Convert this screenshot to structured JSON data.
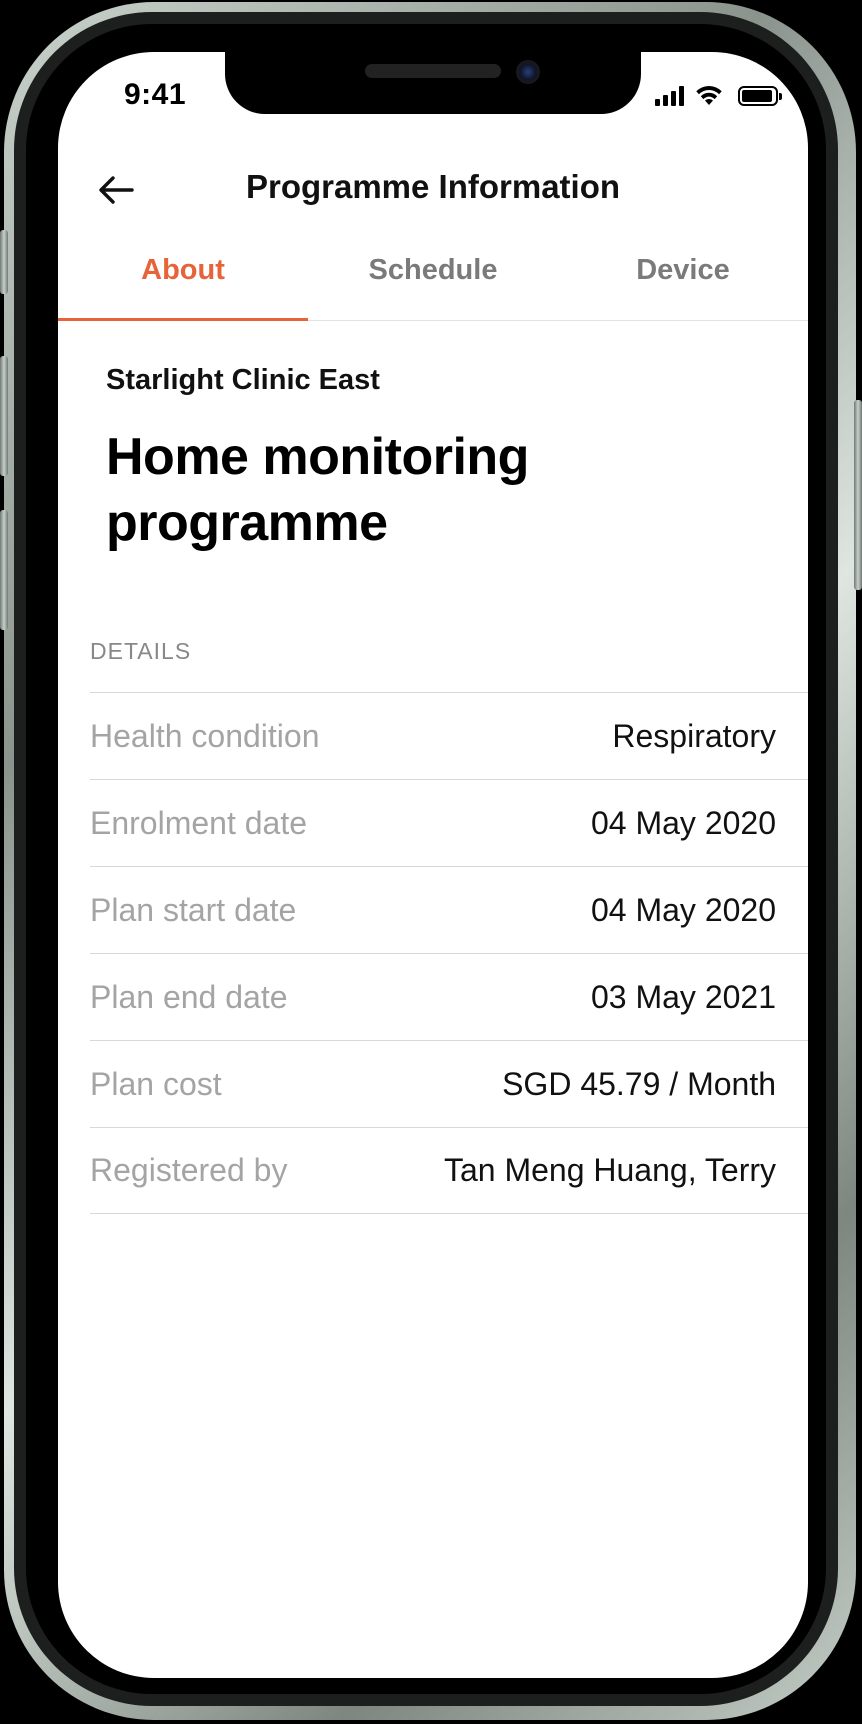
{
  "status_bar": {
    "time": "9:41",
    "battery_level": 0.95
  },
  "header": {
    "title": "Programme Information"
  },
  "tabs": [
    {
      "label": "About",
      "active": true
    },
    {
      "label": "Schedule",
      "active": false
    },
    {
      "label": "Device",
      "active": false
    }
  ],
  "programme": {
    "clinic": "Starlight Clinic East",
    "title": "Home monitoring programme"
  },
  "details": {
    "section_label": "DETAILS",
    "rows": [
      {
        "label": "Health condition",
        "value": "Respiratory"
      },
      {
        "label": "Enrolment date",
        "value": "04 May 2020"
      },
      {
        "label": "Plan start date",
        "value": "04 May 2020"
      },
      {
        "label": "Plan end date",
        "value": "03 May 2021"
      },
      {
        "label": "Plan cost",
        "value": "SGD 45.79 / Month"
      },
      {
        "label": "Registered by",
        "value": "Tan Meng Huang, Terry"
      }
    ]
  },
  "colors": {
    "accent": "#e7643a",
    "label_gray": "#a4a4a4",
    "text": "#111111"
  },
  "icons": {
    "back": "arrow-left-icon",
    "signal": "cellular-signal-icon",
    "wifi": "wifi-icon",
    "battery": "battery-icon"
  }
}
